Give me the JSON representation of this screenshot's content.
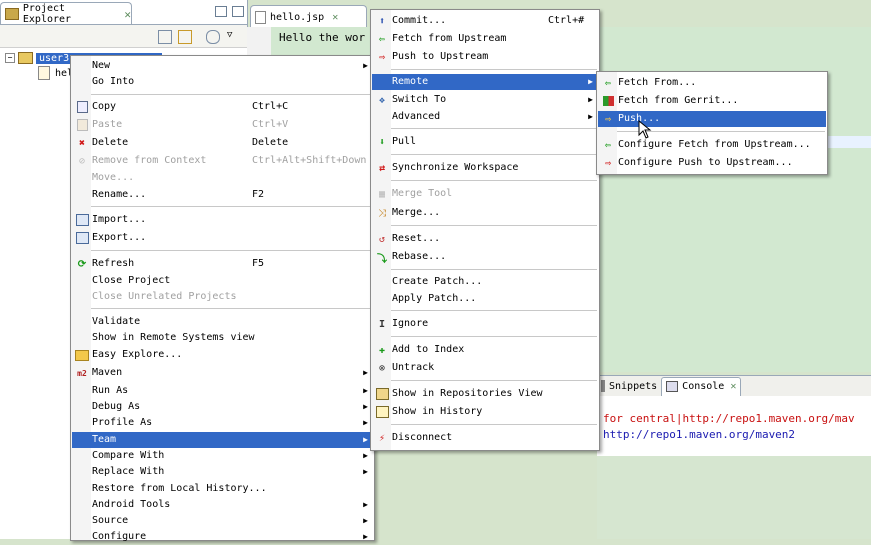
{
  "project_explorer": {
    "tab_label": "Project Explorer",
    "tree": [
      {
        "label": "user3",
        "selected": true
      },
      {
        "label": "hel"
      }
    ]
  },
  "editor": {
    "tab_label": "hello.jsp",
    "text": "Hello the wor"
  },
  "console": {
    "tabs": [
      "Snippets",
      "Console"
    ],
    "lines": [
      {
        "text": "for central|http://repo1.maven.org/mav",
        "color": "#c81010"
      },
      {
        "text": "http://repo1.maven.org/maven2",
        "color": "#1a1ab0"
      }
    ]
  },
  "context_menu": {
    "items": [
      {
        "label": "New",
        "submenu": true
      },
      {
        "label": "Go Into"
      },
      {
        "label": "Copy",
        "shortcut": "Ctrl+C",
        "icon": "copy-icon"
      },
      {
        "label": "Paste",
        "shortcut": "Ctrl+V",
        "icon": "paste-icon",
        "disabled": true
      },
      {
        "label": "Delete",
        "shortcut": "Delete",
        "icon": "delete-icon"
      },
      {
        "label": "Remove from Context",
        "shortcut": "Ctrl+Alt+Shift+Down",
        "icon": "remove-context-icon",
        "disabled": true
      },
      {
        "label": "Move...",
        "disabled": true
      },
      {
        "label": "Rename...",
        "shortcut": "F2"
      },
      {
        "label": "Import...",
        "icon": "import-icon"
      },
      {
        "label": "Export...",
        "icon": "export-icon"
      },
      {
        "label": "Refresh",
        "shortcut": "F5",
        "icon": "refresh-icon"
      },
      {
        "label": "Close Project"
      },
      {
        "label": "Close Unrelated Projects",
        "disabled": true
      },
      {
        "label": "Validate"
      },
      {
        "label": "Show in Remote Systems view"
      },
      {
        "label": "Easy Explore...",
        "icon": "folder-icon"
      },
      {
        "label": "Maven",
        "submenu": true,
        "icon": "maven-icon"
      },
      {
        "label": "Run As",
        "submenu": true
      },
      {
        "label": "Debug As",
        "submenu": true
      },
      {
        "label": "Profile As",
        "submenu": true
      },
      {
        "label": "Team",
        "submenu": true,
        "highlighted": true
      },
      {
        "label": "Compare With",
        "submenu": true
      },
      {
        "label": "Replace With",
        "submenu": true
      },
      {
        "label": "Restore from Local History..."
      },
      {
        "label": "Android Tools",
        "submenu": true
      },
      {
        "label": "Source",
        "submenu": true
      },
      {
        "label": "Configure",
        "submenu": true
      }
    ]
  },
  "team_menu": {
    "items": [
      {
        "label": "Commit...",
        "shortcut": "Ctrl+#",
        "icon": "commit-icon"
      },
      {
        "label": "Fetch from Upstream",
        "icon": "fetch-icon"
      },
      {
        "label": "Push to Upstream",
        "icon": "push-icon"
      },
      {
        "label": "Remote",
        "submenu": true,
        "highlighted": true
      },
      {
        "label": "Switch To",
        "submenu": true,
        "icon": "switch-icon"
      },
      {
        "label": "Advanced",
        "submenu": true
      },
      {
        "label": "Pull",
        "icon": "pull-icon"
      },
      {
        "label": "Synchronize Workspace",
        "icon": "sync-icon"
      },
      {
        "label": "Merge Tool",
        "icon": "merge-tool-icon",
        "disabled": true
      },
      {
        "label": "Merge...",
        "icon": "merge-icon"
      },
      {
        "label": "Reset...",
        "icon": "reset-icon"
      },
      {
        "label": "Rebase...",
        "icon": "rebase-icon"
      },
      {
        "label": "Create Patch..."
      },
      {
        "label": "Apply Patch..."
      },
      {
        "label": "Ignore",
        "icon": "ignore-icon"
      },
      {
        "label": "Add to Index",
        "icon": "add-index-icon"
      },
      {
        "label": "Untrack",
        "icon": "untrack-icon"
      },
      {
        "label": "Show in Repositories View",
        "icon": "repo-view-icon"
      },
      {
        "label": "Show in History",
        "icon": "history-icon"
      },
      {
        "label": "Disconnect",
        "icon": "disconnect-icon"
      }
    ]
  },
  "remote_menu": {
    "items": [
      {
        "label": "Fetch From...",
        "icon": "fetch-icon"
      },
      {
        "label": "Fetch from Gerrit...",
        "icon": "gerrit-icon"
      },
      {
        "label": "Push...",
        "icon": "push-icon",
        "highlighted": true
      },
      {
        "label": "Configure Fetch from Upstream...",
        "icon": "configure-fetch-icon"
      },
      {
        "label": "Configure Push to Upstream...",
        "icon": "configure-push-icon"
      }
    ]
  }
}
